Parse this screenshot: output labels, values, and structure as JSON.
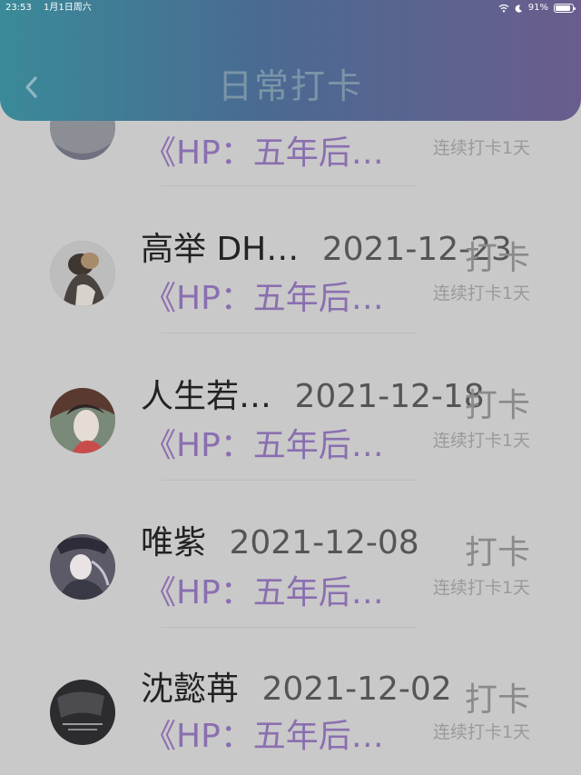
{
  "status_bar": {
    "time": "23:53",
    "date": "1月1日周六",
    "battery": "91%",
    "battery_level": 0.91
  },
  "header": {
    "title": "日常打卡"
  },
  "records": [
    {
      "name": "",
      "date": "",
      "book": "《HP：五年后…",
      "action": "",
      "streak": "连续打卡1天"
    },
    {
      "name": "高举 DH…",
      "date": "2021-12-23",
      "book": "《HP：五年后…",
      "action": "打卡",
      "streak": "连续打卡1天"
    },
    {
      "name": "人生若…",
      "date": "2021-12-18",
      "book": "《HP：五年后…",
      "action": "打卡",
      "streak": "连续打卡1天"
    },
    {
      "name": "唯紫",
      "date": "2021-12-08",
      "book": "《HP：五年后…",
      "action": "打卡",
      "streak": "连续打卡1天"
    },
    {
      "name": "沈懿苒",
      "date": "2021-12-02",
      "book": "《HP：五年后…",
      "action": "打卡",
      "streak": "连续打卡1天"
    }
  ],
  "colors": {
    "header_start": "#3a8a99",
    "header_end": "#6a5d8e",
    "book_title": "#8a6fb0",
    "background": "#c9c9c9"
  }
}
